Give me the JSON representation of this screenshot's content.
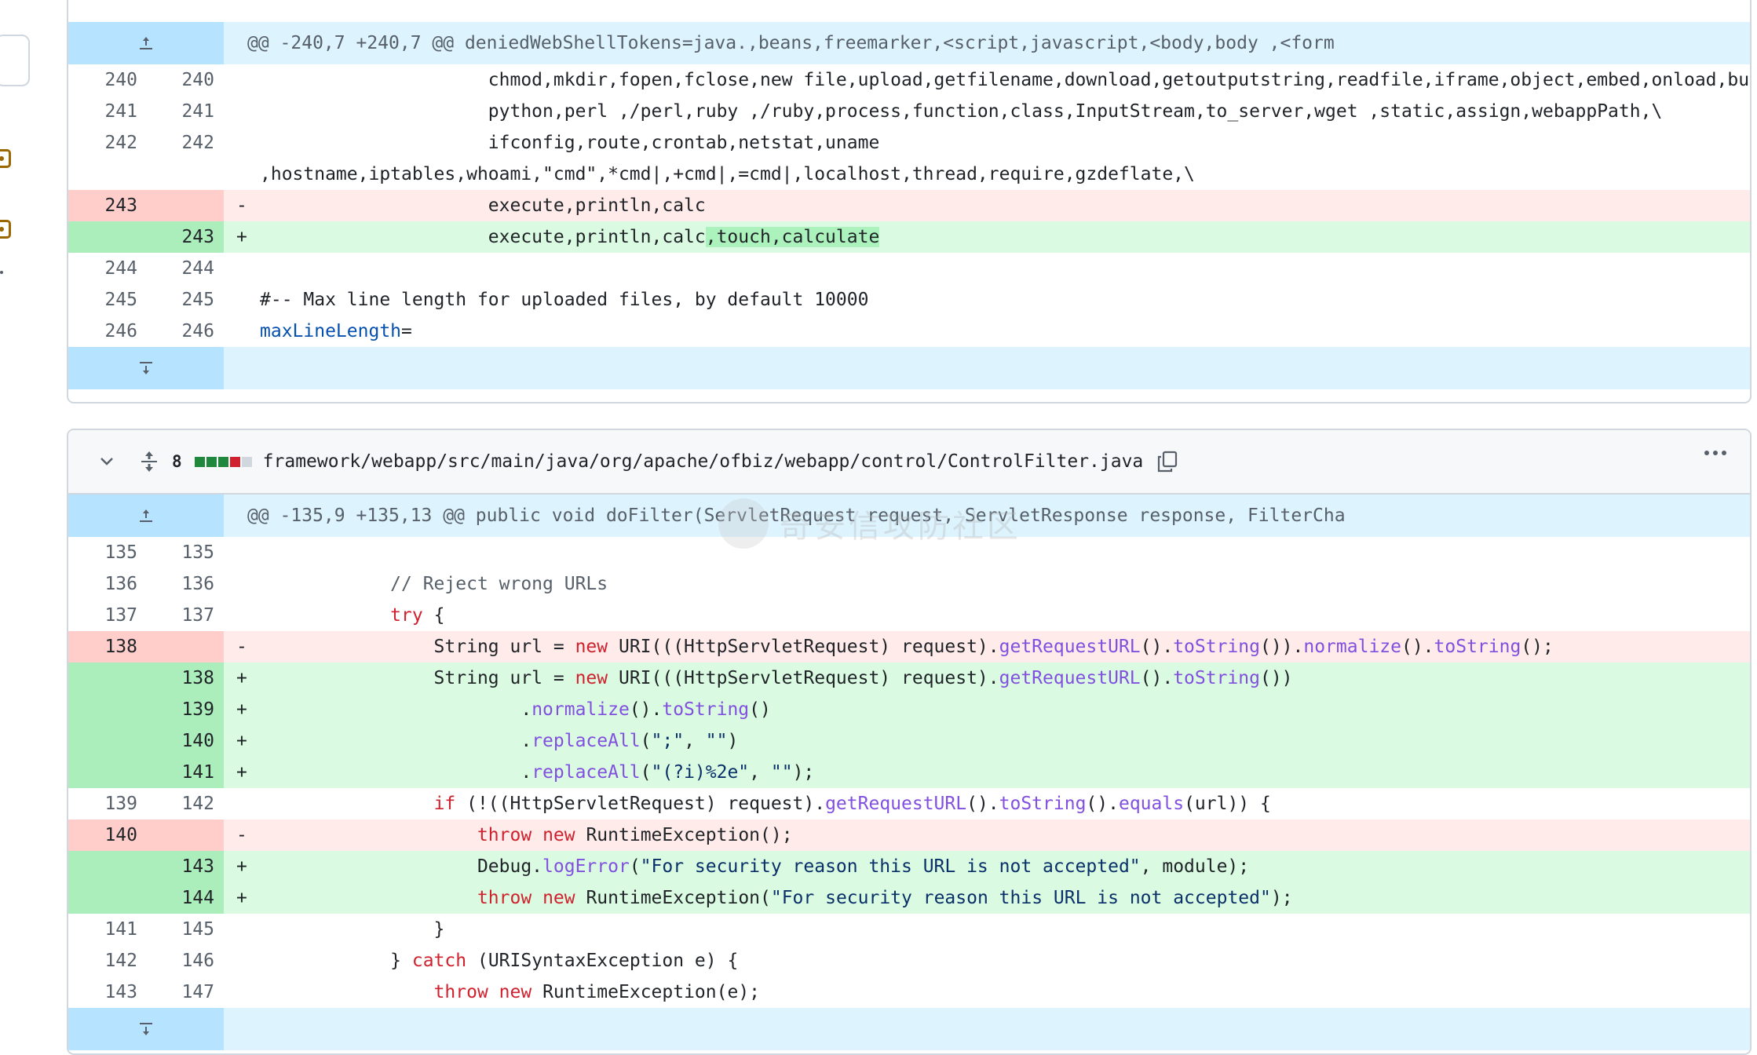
{
  "watermark": "奇安信攻防社区",
  "file_a": {
    "hunk": "@@ -240,7 +240,7 @@ deniedWebShellTokens=java.,beans,freemarker,<script,javascript,<body,body ,<form",
    "rows": [
      {
        "type": "ctx",
        "old": "240",
        "new": "240",
        "sign": "",
        "code": "                     chmod,mkdir,fopen,fclose,new file,upload,getfilename,download,getoutputstring,readfile,iframe,object,embed,onload,build,\\"
      },
      {
        "type": "ctx",
        "old": "241",
        "new": "241",
        "sign": "",
        "code": "                     python,perl ,/perl,ruby ,/ruby,process,function,class,InputStream,to_server,wget ,static,assign,webappPath,\\"
      },
      {
        "type": "ctx",
        "old": "242",
        "new": "242",
        "sign": "",
        "code": "                     ifconfig,route,crontab,netstat,uname"
      },
      {
        "type": "ctx",
        "old": "",
        "new": "",
        "sign": "",
        "code": ",hostname,iptables,whoami,\"cmd\",*cmd|,+cmd|,=cmd|,localhost,thread,require,gzdeflate,\\"
      },
      {
        "type": "del",
        "old": "243",
        "new": "",
        "sign": "-",
        "code": "                     execute,println,calc"
      },
      {
        "type": "add",
        "old": "",
        "new": "243",
        "sign": "+",
        "code": "                     execute,println,calc",
        "hl": ",touch,calculate"
      },
      {
        "type": "ctx",
        "old": "244",
        "new": "244",
        "sign": "",
        "code": ""
      },
      {
        "type": "ctx",
        "old": "245",
        "new": "245",
        "sign": "",
        "code": "#-- Max line length for uploaded files, by default 10000"
      },
      {
        "type": "ctx",
        "old": "246",
        "new": "246",
        "sign": "",
        "code": "maxLineLength="
      }
    ]
  },
  "file_b": {
    "change_count": "8",
    "path": "framework/webapp/src/main/java/org/apache/ofbiz/webapp/control/ControlFilter.java",
    "hunk": "@@ -135,9 +135,13 @@ public void doFilter(ServletRequest request, ServletResponse response, FilterCha",
    "colors": {
      "add": "#1f883d",
      "del": "#cf222e",
      "neutral": "#d0d7de"
    }
  }
}
